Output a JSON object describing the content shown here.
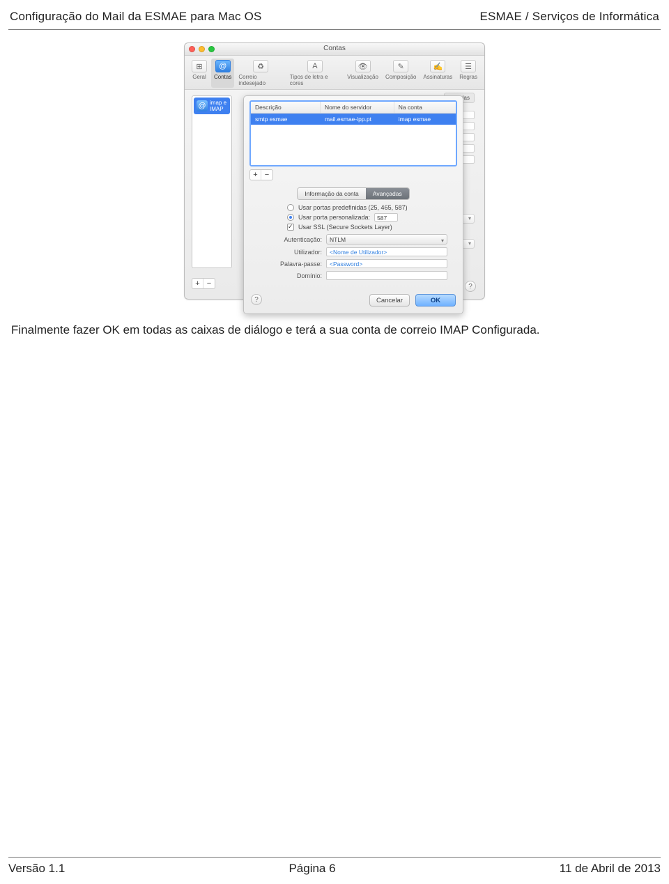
{
  "header": {
    "left": "Configuração do Mail da ESMAE para Mac OS",
    "right": "ESMAE / Serviços de Informática"
  },
  "footer": {
    "left": "Versão 1.1",
    "center": "Página 6",
    "right": "11 de Abril de 2013"
  },
  "caption": "Finalmente fazer OK em todas as caixas de diálogo e terá a sua conta de correio IMAP Configurada.",
  "mac": {
    "window_title": "Contas",
    "toolbar": [
      {
        "label": "Geral",
        "icon": "⊞"
      },
      {
        "label": "Contas",
        "icon": "@",
        "active": true
      },
      {
        "label": "Correio indesejado",
        "icon": "♻"
      },
      {
        "label": "Tipos de letra e cores",
        "icon": "A"
      },
      {
        "label": "Visualização",
        "icon": "👁"
      },
      {
        "label": "Composição",
        "icon": "✎"
      },
      {
        "label": "Assinaturas",
        "icon": "✍"
      },
      {
        "label": "Regras",
        "icon": "☰"
      }
    ],
    "account_badge": {
      "name": "imap e",
      "type": "IMAP"
    },
    "back_tab": "ançadas",
    "sheet": {
      "columns": {
        "desc": "Descrição",
        "server": "Nome do servidor",
        "account": "Na conta"
      },
      "row": {
        "desc": "smtp esmae",
        "server": "mail.esmae-ipp.pt",
        "account": "imap esmae"
      },
      "seg": {
        "left": "Informação da conta",
        "right": "Avançadas"
      },
      "opt_predef": "Usar portas predefinidas (25, 465, 587)",
      "opt_custom": "Usar porta personalizada:",
      "port_value": "587",
      "opt_ssl": "Usar SSL (Secure Sockets Layer)",
      "fields": {
        "auth_label": "Autenticação:",
        "auth_value": "NTLM",
        "user_label": "Utilizador:",
        "user_ph": "<Nome de Utilizador>",
        "pass_label": "Palavra-passe:",
        "pass_ph": "<Password>",
        "domain_label": "Domínio:"
      },
      "buttons": {
        "cancel": "Cancelar",
        "ok": "OK"
      },
      "help": "?"
    }
  }
}
